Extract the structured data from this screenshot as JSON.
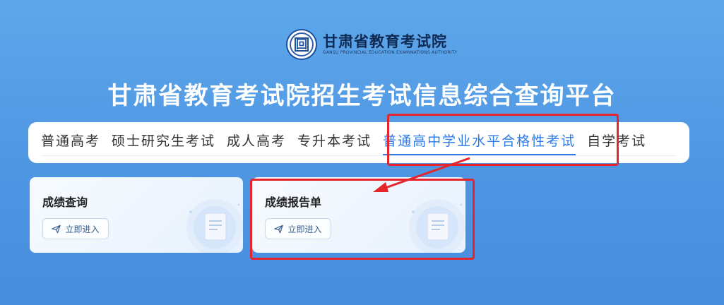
{
  "header": {
    "logo_name": "甘肃省教育考试院",
    "logo_subtitle": "GANSU PROVINCIAL EDUCATION EXAMINATIONS AUTHORITY",
    "emblem_glyph": "回",
    "title": "甘肃省教育考试院招生考试信息综合查询平台"
  },
  "tabs": [
    {
      "label": "普通高考",
      "active": false
    },
    {
      "label": "硕士研究生考试",
      "active": false
    },
    {
      "label": "成人高考",
      "active": false
    },
    {
      "label": "专升本考试",
      "active": false
    },
    {
      "label": "普通高中学业水平合格性考试",
      "active": true
    },
    {
      "label": "自学考试",
      "active": false
    }
  ],
  "cards": [
    {
      "title": "成绩查询",
      "button_label": "立即进入",
      "button_icon": "send-icon"
    },
    {
      "title": "成绩报告单",
      "button_label": "立即进入",
      "button_icon": "send-icon"
    }
  ],
  "colors": {
    "active_tab": "#2e7be6",
    "annotation_red": "#e5242b",
    "background": "#4d95e2"
  }
}
